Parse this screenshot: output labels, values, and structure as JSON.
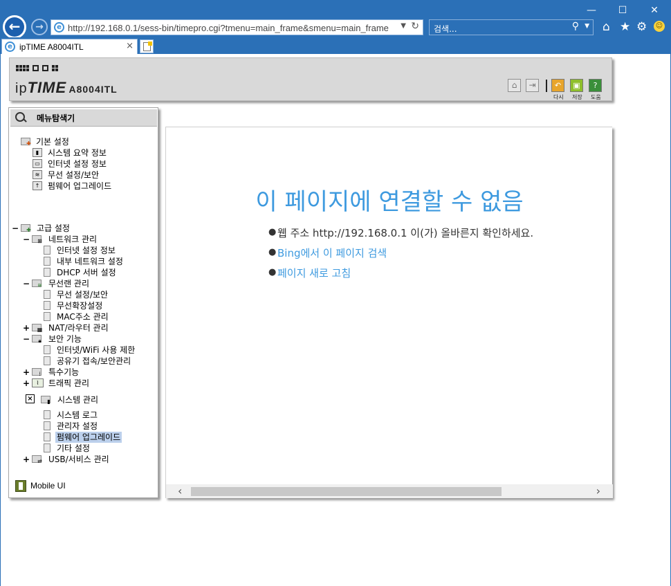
{
  "browser": {
    "address_url": "http://192.168.0.1/sess-bin/timepro.cgi?tmenu=main_frame&smenu=main_frame",
    "search_placeholder": "검색...",
    "tab_title": "ipTIME A8004ITL",
    "tab_close": "×",
    "window_controls": [
      "minimize-icon",
      "maximize-icon",
      "close-icon"
    ]
  },
  "router_header": {
    "brand_ip": "ip",
    "brand_time": "TIME",
    "model": "A8004ITL",
    "actions": [
      {
        "label": "다시",
        "icon": "undo-icon",
        "color": "#e8a52c"
      },
      {
        "label": "저장",
        "icon": "save-icon",
        "color": "#8fbf2c"
      },
      {
        "label": "도움",
        "icon": "help-icon",
        "color": "#3a8f3a"
      }
    ],
    "nav_icons": [
      "home-icon",
      "logout-icon"
    ]
  },
  "sidebar": {
    "title": "메뉴탐색기",
    "basic": {
      "label": "기본 설정",
      "items": [
        "시스템 요약 정보",
        "인터넷 설정 정보",
        "무선 설정/보안",
        "펌웨어 업그레이드"
      ]
    },
    "advanced": {
      "toggle": "−",
      "label": "고급 설정",
      "network": {
        "toggle": "−",
        "label": "네트워크 관리",
        "items": [
          "인터넷 설정 정보",
          "내부 네트워크 설정",
          "DHCP 서버 설정"
        ]
      },
      "wireless": {
        "toggle": "−",
        "label": "무선랜 관리",
        "items": [
          "무선 설정/보안",
          "무선확장설정",
          "MAC주소 관리"
        ]
      },
      "nat": {
        "toggle": "+",
        "label": "NAT/라우터 관리"
      },
      "security": {
        "toggle": "−",
        "label": "보안 기능",
        "items": [
          "인터넷/WiFi 사용 제한",
          "공유기 접속/보안관리"
        ]
      },
      "special": {
        "toggle": "+",
        "label": "특수기능"
      },
      "traffic": {
        "toggle": "+",
        "label": "트래픽 관리"
      },
      "system": {
        "toggle": "×",
        "label": "시스템 관리",
        "items": [
          "시스템 로그",
          "관리자 설정",
          "펌웨어 업그레이드",
          "기타 설정"
        ],
        "selected_index": 2
      },
      "usb": {
        "toggle": "+",
        "label": "USB/서비스 관리"
      }
    },
    "mobile_ui": "Mobile UI"
  },
  "main": {
    "error_title": "이 페이지에 연결할 수 없음",
    "bullets": [
      {
        "text": "웹 주소 http://192.168.0.1 이(가) 올바른지 확인하세요.",
        "link": false
      },
      {
        "text": "Bing에서 이 페이지 검색",
        "link": true
      },
      {
        "text": "페이지 새로 고침",
        "link": true
      }
    ],
    "scroll_left": "‹",
    "scroll_right": "›"
  }
}
